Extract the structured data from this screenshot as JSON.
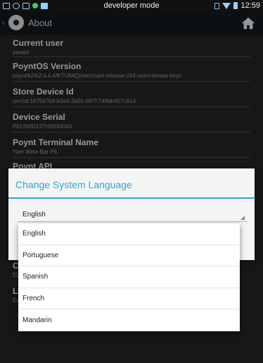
{
  "status_bar": {
    "mode_label": "developer mode",
    "time": "12:59"
  },
  "action_bar": {
    "back_glyph": "‹",
    "title": "About"
  },
  "about_items": [
    {
      "label": "Current user",
      "value": "yamini"
    },
    {
      "label": "PoyntOS Version",
      "value": "poynt/k2/k2:4.4.4/KTU84Q/merchant-release-264:user/release-keys"
    },
    {
      "label": "Store Device Id",
      "value": "urn:tid:167567b8-b2e3-3a01-b97f-749bb657c91d"
    },
    {
      "label": "Device Serial",
      "value": "P61SWD137HS034043"
    },
    {
      "label": "Poynt Terminal Name",
      "value": "Yam Wine Bar P6"
    },
    {
      "label": "Poynt API",
      "value": ""
    },
    {
      "label": "C",
      "value": "El"
    },
    {
      "label": "La",
      "value": "En"
    }
  ],
  "dialog": {
    "title": "Change System Language",
    "selected_language": "English"
  },
  "language_options": [
    "English",
    "Portuguese",
    "Spanish",
    "French",
    "Mandarin"
  ],
  "colors": {
    "accent": "#2aa7d6",
    "background": "#242424",
    "action_bar": "#14191e"
  }
}
